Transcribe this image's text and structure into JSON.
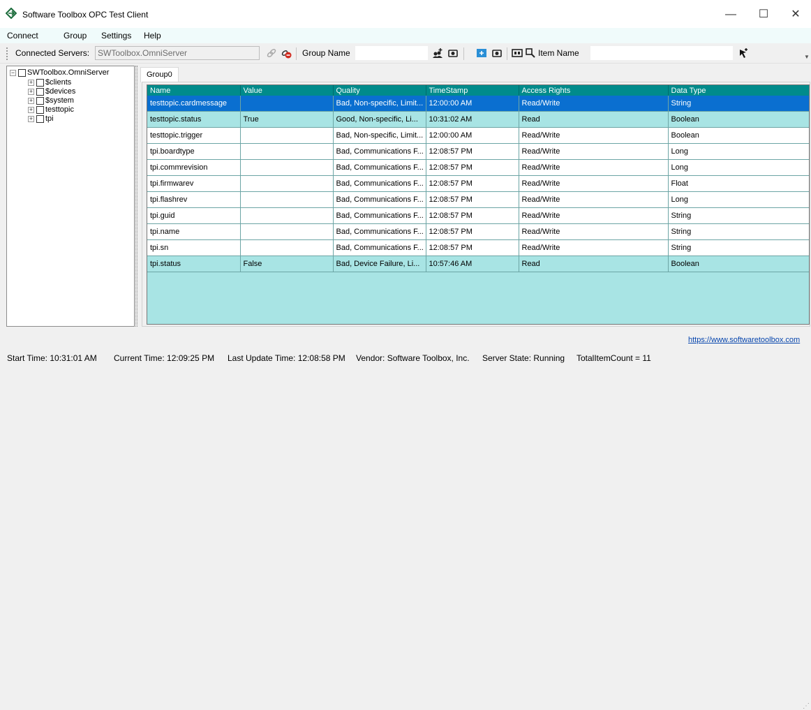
{
  "window": {
    "title": "Software Toolbox OPC Test Client",
    "minimize": "—",
    "maximize": "☐",
    "close": "✕"
  },
  "menu": [
    "Connect",
    "Group",
    "Settings",
    "Help"
  ],
  "toolbar": {
    "servers_label": "Connected Servers:",
    "servers_value": "SWToolbox.OmniServer",
    "group_label": "Group Name",
    "group_value": "",
    "item_label": "Item Name",
    "item_value": ""
  },
  "tree": {
    "root": "SWToolbox.OmniServer",
    "children": [
      "$clients",
      "$devices",
      "$system",
      "testtopic",
      "tpi"
    ]
  },
  "tab": "Group0",
  "table": {
    "columns": [
      "Name",
      "Value",
      "Quality",
      "TimeStamp",
      "Access Rights",
      "Data Type"
    ],
    "rows": [
      [
        "testtopic.cardmessage",
        "",
        "Bad, Non-specific, Limit...",
        "12:00:00 AM",
        "Read/Write",
        "String"
      ],
      [
        "testtopic.status",
        "True",
        "Good, Non-specific, Li...",
        "10:31:02 AM",
        "Read",
        "Boolean"
      ],
      [
        "testtopic.trigger",
        "",
        "Bad, Non-specific, Limit...",
        "12:00:00 AM",
        "Read/Write",
        "Boolean"
      ],
      [
        "tpi.boardtype",
        "",
        "Bad, Communications F...",
        "12:08:57 PM",
        "Read/Write",
        "Long"
      ],
      [
        "tpi.commrevision",
        "",
        "Bad, Communications F...",
        "12:08:57 PM",
        "Read/Write",
        "Long"
      ],
      [
        "tpi.firmwarev",
        "",
        "Bad, Communications F...",
        "12:08:57 PM",
        "Read/Write",
        "Float"
      ],
      [
        "tpi.flashrev",
        "",
        "Bad, Communications F...",
        "12:08:57 PM",
        "Read/Write",
        "Long"
      ],
      [
        "tpi.guid",
        "",
        "Bad, Communications F...",
        "12:08:57 PM",
        "Read/Write",
        "String"
      ],
      [
        "tpi.name",
        "",
        "Bad, Communications F...",
        "12:08:57 PM",
        "Read/Write",
        "String"
      ],
      [
        "tpi.sn",
        "",
        "Bad, Communications F...",
        "12:08:57 PM",
        "Read/Write",
        "String"
      ],
      [
        "tpi.status",
        "False",
        "Bad, Device Failure, Li...",
        "10:57:46 AM",
        "Read",
        "Boolean"
      ]
    ],
    "row_styles": [
      "selected",
      "cyan",
      "white",
      "white",
      "white",
      "white",
      "white",
      "white",
      "white",
      "white",
      "cyan"
    ]
  },
  "link": "https://www.softwaretoolbox.com",
  "status": {
    "start_time": "Start Time: 10:31:01 AM",
    "current_time": "Current Time: 12:09:25 PM",
    "last_update": "Last Update Time: 12:08:58 PM",
    "vendor": "Vendor: Software Toolbox, Inc.",
    "server_state": "Server State: Running",
    "item_count": "TotalItemCount = 11"
  },
  "colors": {
    "header": "#008b8b",
    "row_cyan": "#a8e4e4",
    "selection": "#0a6fd0",
    "menubar": "#f0fbfb"
  }
}
